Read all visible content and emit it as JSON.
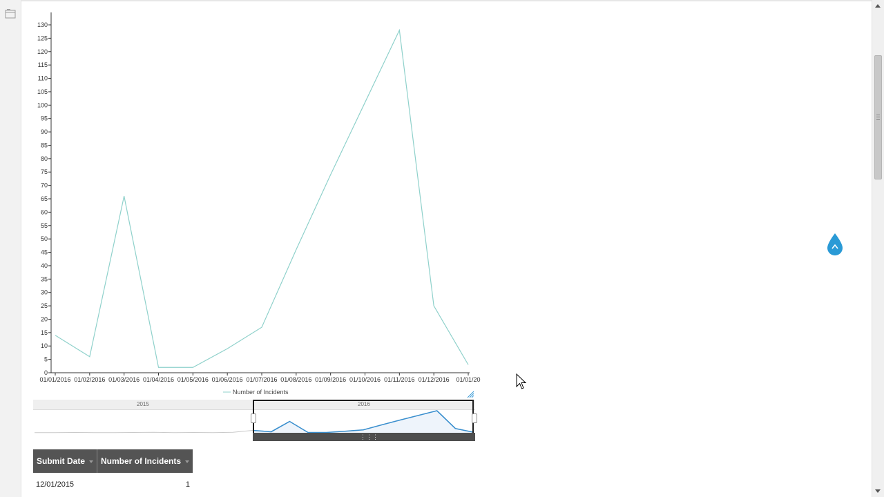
{
  "chart_data": {
    "type": "line",
    "title": "",
    "xlabel": "",
    "ylabel": "",
    "x": [
      "01/01/2016",
      "01/02/2016",
      "01/03/2016",
      "01/04/2016",
      "01/05/2016",
      "01/06/2016",
      "01/07/2016",
      "01/08/2016",
      "01/09/2016",
      "01/10/2016",
      "01/11/2016",
      "01/12/2016",
      "01/01/20"
    ],
    "series": [
      {
        "name": "Number of Incidents",
        "values": [
          14,
          6,
          66,
          2,
          2,
          9,
          17,
          46,
          74,
          101,
          128,
          25,
          3
        ]
      }
    ],
    "yticks": [
      0,
      5,
      10,
      15,
      20,
      25,
      30,
      35,
      40,
      45,
      50,
      55,
      60,
      65,
      70,
      75,
      80,
      85,
      90,
      95,
      100,
      105,
      110,
      115,
      120,
      125,
      130
    ],
    "ylim": [
      0,
      130
    ],
    "grid": false,
    "legend_position": "bottom",
    "line_color": "#8fd1cb"
  },
  "navigator": {
    "years": [
      "2015",
      "2016"
    ],
    "preview_values": [
      1,
      1,
      2,
      1,
      1,
      2,
      3,
      1,
      2,
      1,
      3,
      14,
      6,
      66,
      2,
      2,
      9,
      17,
      46,
      74,
      101,
      128,
      25,
      3
    ],
    "selection_start_index": 11,
    "line_color": "#3a8fce",
    "fill_color": "#eef4fb"
  },
  "table": {
    "headers": [
      "Submit Date",
      "Number of Incidents"
    ],
    "rows": [
      {
        "date": "12/01/2015",
        "count": "1"
      }
    ]
  },
  "colors": {
    "fab": "#2a9ad6",
    "header_bg": "#545454"
  },
  "icons": {
    "rail": "folder-icon",
    "fab": "chevron-up-icon",
    "resize": "resize-handle-icon"
  }
}
